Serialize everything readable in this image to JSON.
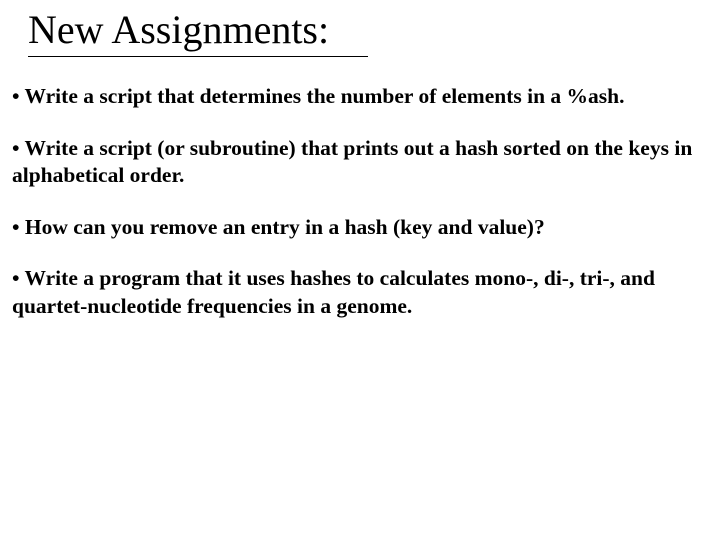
{
  "title": "New Assignments:",
  "bullets": [
    "Write a script that determines the number of elements in a %ash.",
    "Write a script (or subroutine) that prints out a hash sorted on the keys in alphabetical order.",
    "How can you remove an entry in a hash (key and value)?",
    "Write a program that it uses hashes to calculates mono-, di-, tri-, and quartet-nucleotide frequencies in a genome."
  ],
  "bullet_char": "•"
}
